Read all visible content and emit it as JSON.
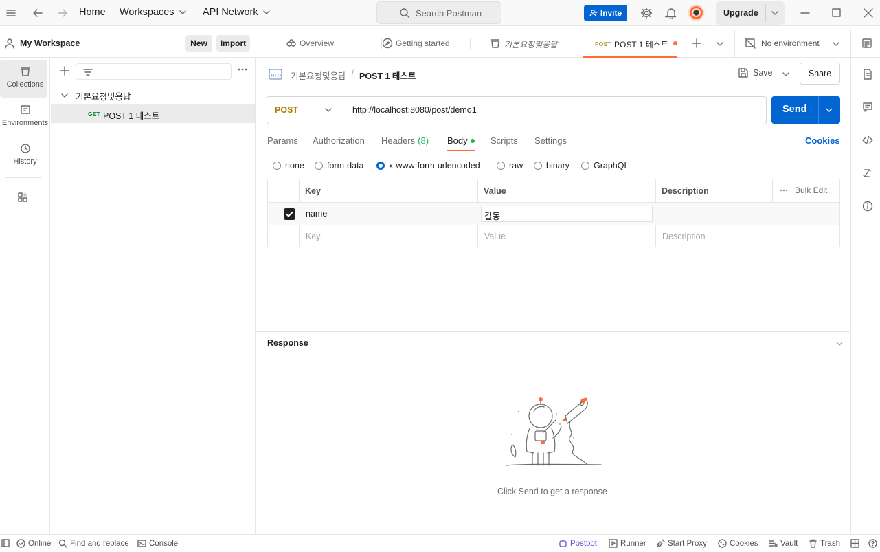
{
  "colors": {
    "accent": "#0265d2",
    "unsaved_dot": "#ff6c37",
    "body_dot": "#0cbb52",
    "method_post": "#ad7a03",
    "method_get": "#007f31"
  },
  "topbar": {
    "home": "Home",
    "workspaces": "Workspaces",
    "api_network": "API Network",
    "search_placeholder": "Search Postman",
    "invite": "Invite",
    "upgrade": "Upgrade"
  },
  "workspace": {
    "title": "My Workspace",
    "new_btn": "New",
    "import_btn": "Import"
  },
  "rail": {
    "items": [
      {
        "label": "Collections",
        "icon": "collections-icon"
      },
      {
        "label": "Environments",
        "icon": "environments-icon"
      },
      {
        "label": "History",
        "icon": "history-icon"
      }
    ]
  },
  "tree": {
    "collection": "기본요청및응답",
    "request_method": "GET",
    "request_name": "POST 1 테스트"
  },
  "tabs": [
    {
      "label": "Overview",
      "icon": "overview-icon"
    },
    {
      "label": "Getting started",
      "icon": "getting-started-icon"
    },
    {
      "label": "기본요청및응답",
      "icon": "collection-icon"
    },
    {
      "method": "POST",
      "label": "POST 1 테스트",
      "active": true
    }
  ],
  "environment": "No environment",
  "breadcrumb": {
    "collection": "기본요청및응답",
    "sep": "/",
    "request": "POST 1 테스트"
  },
  "actions": {
    "save": "Save",
    "share": "Share"
  },
  "request": {
    "method": "POST",
    "url": "http://localhost:8080/post/demo1",
    "send": "Send"
  },
  "subtabs": {
    "params": "Params",
    "authorization": "Authorization",
    "headers": "Headers",
    "headers_count": "(8)",
    "body": "Body",
    "scripts": "Scripts",
    "settings": "Settings",
    "cookies": "Cookies"
  },
  "body_types": [
    "none",
    "form-data",
    "x-www-form-urlencoded",
    "raw",
    "binary",
    "GraphQL"
  ],
  "body_selected": "x-www-form-urlencoded",
  "table": {
    "headers": {
      "key": "Key",
      "value": "Value",
      "description": "Description",
      "bulk_edit": "Bulk Edit"
    },
    "rows": [
      {
        "checked": true,
        "key": "name",
        "value": "길동",
        "description": ""
      }
    ],
    "placeholder": {
      "key": "Key",
      "value": "Value",
      "description": "Description"
    }
  },
  "response": {
    "title": "Response",
    "empty_text": "Click Send to get a response"
  },
  "statusbar": {
    "online": "Online",
    "find_replace": "Find and replace",
    "console": "Console",
    "postbot": "Postbot",
    "runner": "Runner",
    "start_proxy": "Start Proxy",
    "cookies": "Cookies",
    "vault": "Vault",
    "trash": "Trash"
  }
}
